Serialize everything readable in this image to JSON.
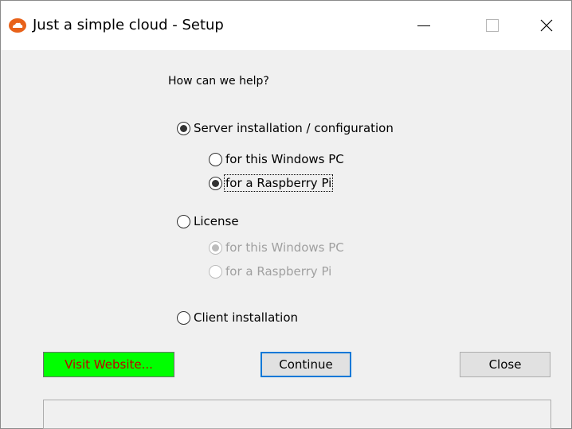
{
  "window": {
    "title": "Just a simple cloud - Setup",
    "title_icon": "cloud-icon",
    "controls": [
      "minimize-icon",
      "maximize-icon",
      "close-icon"
    ]
  },
  "prompt": "How can we help?",
  "options": {
    "server": {
      "label": "Server installation / configuration",
      "checked": true
    },
    "server_windows": {
      "label": "for this Windows PC",
      "checked": false
    },
    "server_pi": {
      "label": "for a Raspberry Pi",
      "checked": true
    },
    "license": {
      "label": "License",
      "checked": false
    },
    "license_windows": {
      "label": "for this Windows PC",
      "checked": true,
      "disabled": true
    },
    "license_pi": {
      "label": "for a Raspberry Pi",
      "checked": false,
      "disabled": true
    },
    "client": {
      "label": "Client installation",
      "checked": false
    }
  },
  "buttons": {
    "website": "Visit Website...",
    "continue": "Continue",
    "close": "Close"
  },
  "status": "",
  "colors": {
    "app_icon": "#e8621a",
    "website_bg": "#00ff00",
    "website_text": "#c00000",
    "focus_border": "#0078d7"
  }
}
